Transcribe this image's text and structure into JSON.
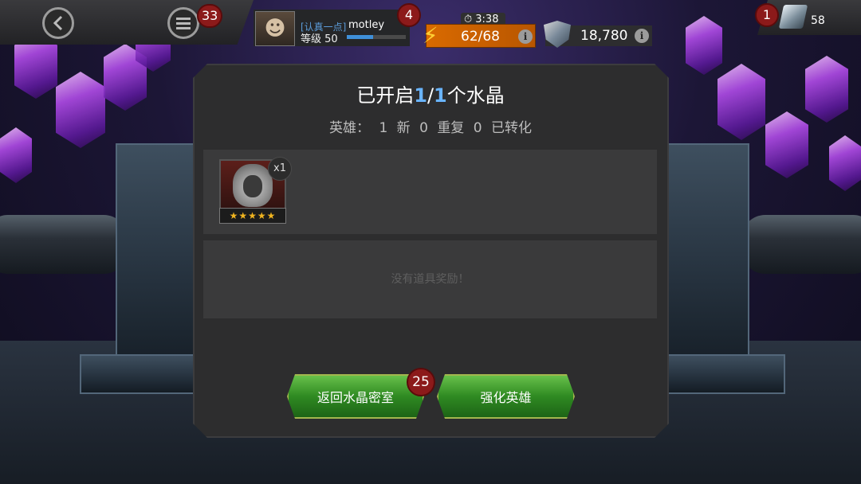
{
  "hud": {
    "menu_badge": "33",
    "profile_badge": "4",
    "player_tag": "[认真一点]",
    "player_name": "motley",
    "player_level": "等级 50",
    "timer": "3:38",
    "energy": "62/68",
    "gold": "18,780",
    "crystal_badge": "1",
    "crystal_count": "58",
    "xp_progress": 0.45
  },
  "modal": {
    "title_prefix": "已开启",
    "title_opened": "1",
    "title_sep": "/",
    "title_total": "1",
    "title_suffix": "个水晶",
    "summary_label": "英雄：",
    "summary_new_count": "1",
    "summary_new_label": "新",
    "summary_dup_count": "0",
    "summary_dup_label": "重复",
    "summary_conv_count": "0",
    "summary_conv_label": "已转化",
    "hero": {
      "quantity": "x1",
      "stars": "★★★★★"
    },
    "no_items_text": "没有道具奖励！",
    "return_button": "返回水晶密室",
    "return_badge": "25",
    "upgrade_button": "强化英雄"
  },
  "colors": {
    "accent_blue": "#69b4ff",
    "energy_orange": "#d96a00",
    "button_green": "#2f8a22",
    "badge_red": "#8c1a1a"
  }
}
